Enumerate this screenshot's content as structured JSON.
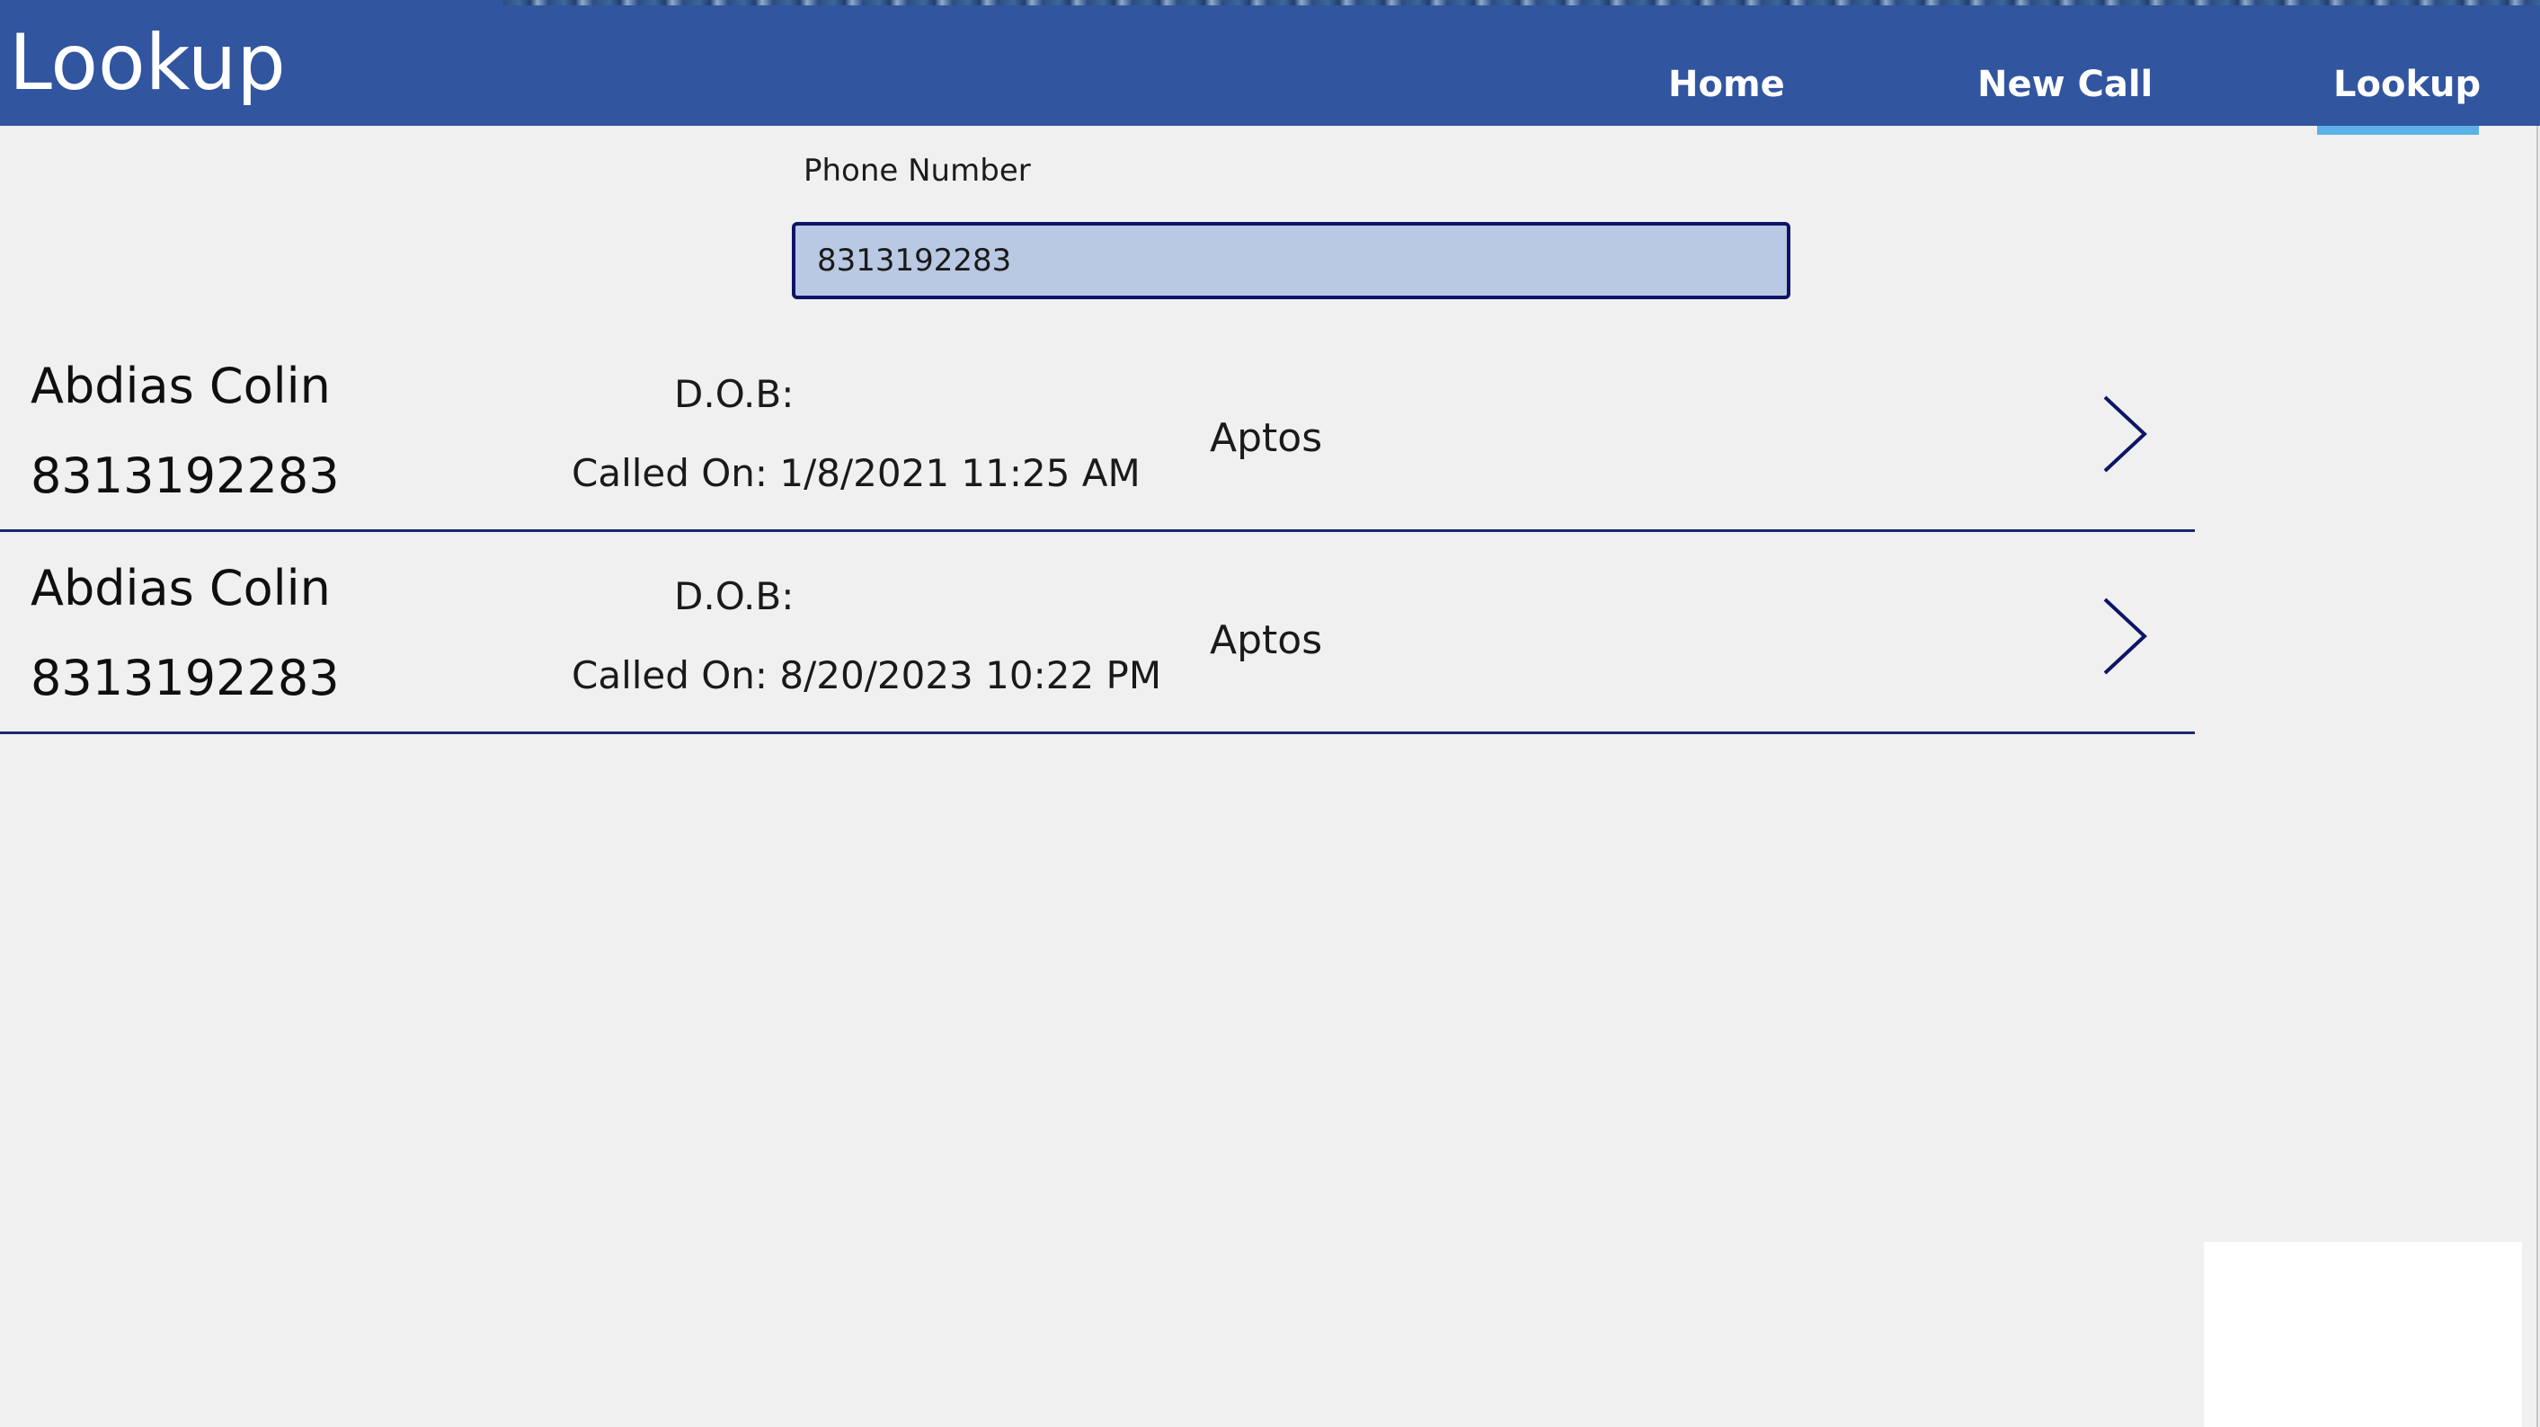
{
  "header": {
    "title": "Lookup",
    "nav": {
      "home": "Home",
      "new_call": "New Call",
      "lookup": "Lookup"
    },
    "active_nav": "Lookup"
  },
  "search": {
    "label": "Phone Number",
    "value": "8313192283"
  },
  "records": [
    {
      "name": "Abdias Colin",
      "phone": "8313192283",
      "dob": "D.O.B:",
      "called_on": "Called On: 1/8/2021 11:25 AM",
      "city": "Aptos"
    },
    {
      "name": "Abdias Colin",
      "phone": "8313192283",
      "dob": "D.O.B:",
      "called_on": "Called On: 8/20/2023 10:22 PM",
      "city": "Aptos"
    }
  ],
  "icons": {
    "row_chevron": "chevron-right-icon"
  },
  "colors": {
    "header_bg": "#31559f",
    "accent_underline": "#5cb2e6",
    "input_bg": "#b9c9e3",
    "input_border": "#0e1466",
    "divider": "#1a2a6c",
    "page_bg": "#f0f0f0"
  }
}
